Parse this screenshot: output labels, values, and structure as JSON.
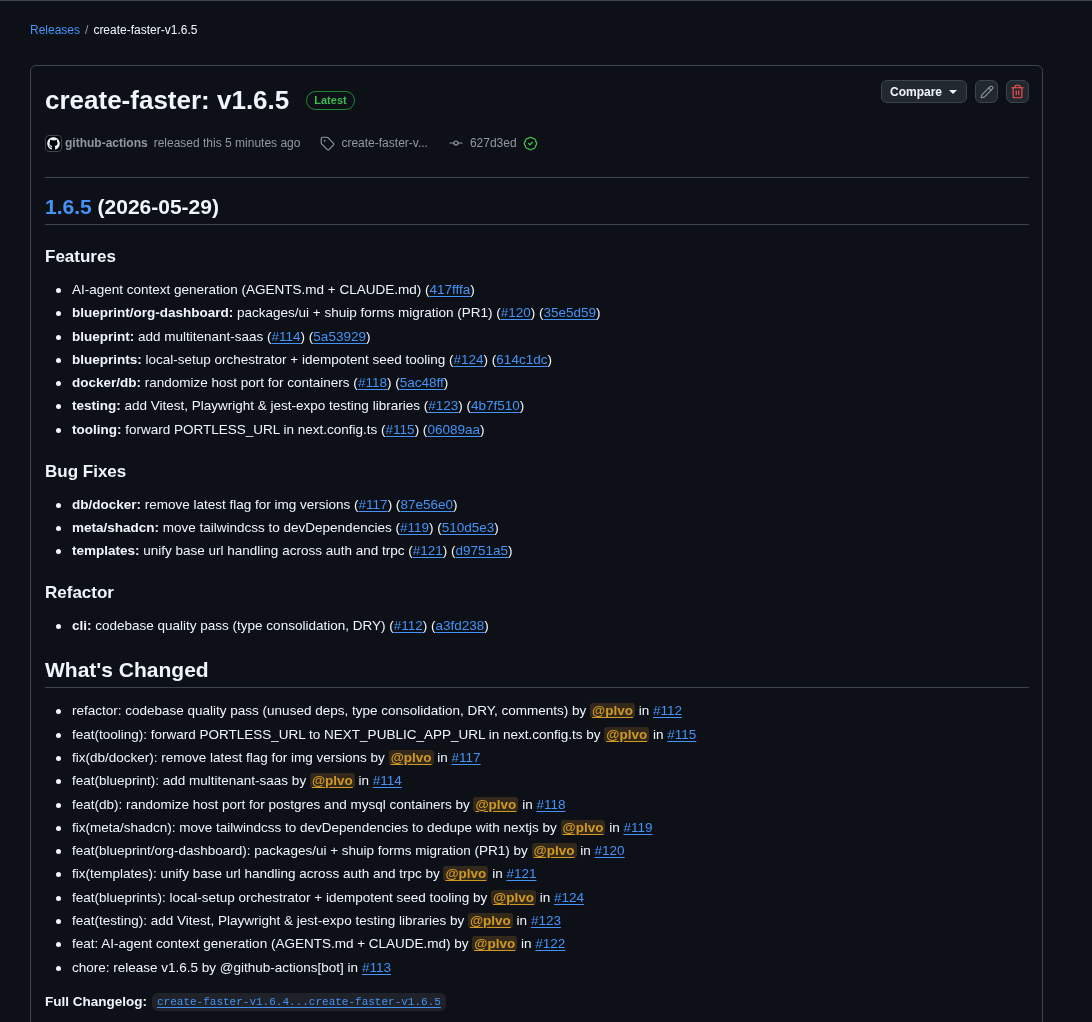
{
  "breadcrumb": {
    "parent": "Releases",
    "separator": "/",
    "current": "create-faster-v1.6.5"
  },
  "release": {
    "title": "create-faster: v1.6.5",
    "badge": "Latest"
  },
  "actions": [
    {
      "kind": "dropdown",
      "label": "Compare"
    },
    {
      "kind": "edit"
    },
    {
      "kind": "delete"
    }
  ],
  "meta": {
    "author": "github-actions",
    "action": "released this 5 minutes ago",
    "tag": "create-faster-v...",
    "commit": "627d3ed",
    "verified": true
  },
  "version": {
    "link": "1.6.5",
    "date": "(2026-05-29)"
  },
  "sections": [
    {
      "heading": "Features",
      "items": [
        {
          "parts": [
            {
              "kind": "text",
              "text": "AI-agent context generation (AGENTS.md + CLAUDE.md) ("
            },
            {
              "kind": "commit",
              "text": "417fffa"
            },
            {
              "kind": "text",
              "text": ")"
            }
          ]
        },
        {
          "parts": [
            {
              "kind": "text",
              "text": "**blueprint/org-dashboard:** packages/ui + shuip forms migration (PR1) ("
            },
            {
              "kind": "pr",
              "text": "#120"
            },
            {
              "kind": "text",
              "text": ") ("
            },
            {
              "kind": "commit",
              "text": "35e5d59"
            },
            {
              "kind": "text",
              "text": ")"
            }
          ]
        },
        {
          "parts": [
            {
              "kind": "text",
              "text": "**blueprint:** add multitenant-saas ("
            },
            {
              "kind": "pr",
              "text": "#114"
            },
            {
              "kind": "text",
              "text": ") ("
            },
            {
              "kind": "commit",
              "text": "5a53929"
            },
            {
              "kind": "text",
              "text": ")"
            }
          ]
        },
        {
          "parts": [
            {
              "kind": "text",
              "text": "**blueprints:** local-setup orchestrator + idempotent seed tooling ("
            },
            {
              "kind": "pr",
              "text": "#124"
            },
            {
              "kind": "text",
              "text": ") ("
            },
            {
              "kind": "commit",
              "text": "614c1dc"
            },
            {
              "kind": "text",
              "text": ")"
            }
          ]
        },
        {
          "parts": [
            {
              "kind": "text",
              "text": "**docker/db:** randomize host port for containers ("
            },
            {
              "kind": "pr",
              "text": "#118"
            },
            {
              "kind": "text",
              "text": ") ("
            },
            {
              "kind": "commit",
              "text": "5ac48ff"
            },
            {
              "kind": "text",
              "text": ")"
            }
          ]
        },
        {
          "parts": [
            {
              "kind": "text",
              "text": "**testing:** add Vitest, Playwright & jest-expo testing libraries ("
            },
            {
              "kind": "pr",
              "text": "#123"
            },
            {
              "kind": "text",
              "text": ") ("
            },
            {
              "kind": "commit",
              "text": "4b7f510"
            },
            {
              "kind": "text",
              "text": ")"
            }
          ]
        },
        {
          "parts": [
            {
              "kind": "text",
              "text": "**tooling:** forward PORTLESS_URL in next.config.ts ("
            },
            {
              "kind": "pr",
              "text": "#115"
            },
            {
              "kind": "text",
              "text": ") ("
            },
            {
              "kind": "commit",
              "text": "06089aa"
            },
            {
              "kind": "text",
              "text": ")"
            }
          ]
        }
      ]
    },
    {
      "heading": "Bug Fixes",
      "items": [
        {
          "parts": [
            {
              "kind": "text",
              "text": "**db/docker:** remove latest flag for img versions ("
            },
            {
              "kind": "pr",
              "text": "#117"
            },
            {
              "kind": "text",
              "text": ") ("
            },
            {
              "kind": "commit",
              "text": "87e56e0"
            },
            {
              "kind": "text",
              "text": ")"
            }
          ]
        },
        {
          "parts": [
            {
              "kind": "text",
              "text": "**meta/shadcn:** move tailwindcss to devDependencies ("
            },
            {
              "kind": "pr",
              "text": "#119"
            },
            {
              "kind": "text",
              "text": ") ("
            },
            {
              "kind": "commit",
              "text": "510d5e3"
            },
            {
              "kind": "text",
              "text": ")"
            }
          ]
        },
        {
          "parts": [
            {
              "kind": "text",
              "text": "**templates:** unify base url handling across auth and trpc ("
            },
            {
              "kind": "pr",
              "text": "#121"
            },
            {
              "kind": "text",
              "text": ") ("
            },
            {
              "kind": "commit",
              "text": "d9751a5"
            },
            {
              "kind": "text",
              "text": ")"
            }
          ]
        }
      ]
    },
    {
      "heading": "Refactor",
      "items": [
        {
          "parts": [
            {
              "kind": "text",
              "text": "**cli:** codebase quality pass (type consolidation, DRY) ("
            },
            {
              "kind": "pr",
              "text": "#112"
            },
            {
              "kind": "text",
              "text": ") ("
            },
            {
              "kind": "commit",
              "text": "a3fd238"
            },
            {
              "kind": "text",
              "text": ")"
            }
          ]
        }
      ]
    }
  ],
  "whats_changed": {
    "heading": "What's Changed",
    "items": [
      {
        "parts": [
          {
            "kind": "text",
            "text": "refactor: codebase quality pass (unused deps, type consolidation, DRY, comments) by "
          },
          {
            "kind": "mention",
            "text": "@plvo"
          },
          {
            "kind": "text",
            "text": " in "
          },
          {
            "kind": "pr",
            "text": "#112"
          }
        ]
      },
      {
        "parts": [
          {
            "kind": "text",
            "text": "feat(tooling): forward PORTLESS_URL to NEXT_PUBLIC_APP_URL in next.config.ts by "
          },
          {
            "kind": "mention",
            "text": "@plvo"
          },
          {
            "kind": "text",
            "text": " in "
          },
          {
            "kind": "pr",
            "text": "#115"
          }
        ]
      },
      {
        "parts": [
          {
            "kind": "text",
            "text": "fix(db/docker): remove latest flag for img versions by "
          },
          {
            "kind": "mention",
            "text": "@plvo"
          },
          {
            "kind": "text",
            "text": " in "
          },
          {
            "kind": "pr",
            "text": "#117"
          }
        ]
      },
      {
        "parts": [
          {
            "kind": "text",
            "text": "feat(blueprint): add multitenant-saas by "
          },
          {
            "kind": "mention",
            "text": "@plvo"
          },
          {
            "kind": "text",
            "text": " in "
          },
          {
            "kind": "pr",
            "text": "#114"
          }
        ]
      },
      {
        "parts": [
          {
            "kind": "text",
            "text": "feat(db): randomize host port for postgres and mysql containers by "
          },
          {
            "kind": "mention",
            "text": "@plvo"
          },
          {
            "kind": "text",
            "text": " in "
          },
          {
            "kind": "pr",
            "text": "#118"
          }
        ]
      },
      {
        "parts": [
          {
            "kind": "text",
            "text": "fix(meta/shadcn): move tailwindcss to devDependencies to dedupe with nextjs by "
          },
          {
            "kind": "mention",
            "text": "@plvo"
          },
          {
            "kind": "text",
            "text": " in "
          },
          {
            "kind": "pr",
            "text": "#119"
          }
        ]
      },
      {
        "parts": [
          {
            "kind": "text",
            "text": "feat(blueprint/org-dashboard): packages/ui + shuip forms migration (PR1) by "
          },
          {
            "kind": "mention",
            "text": "@plvo"
          },
          {
            "kind": "text",
            "text": " in "
          },
          {
            "kind": "pr",
            "text": "#120"
          }
        ]
      },
      {
        "parts": [
          {
            "kind": "text",
            "text": "fix(templates): unify base url handling across auth and trpc by "
          },
          {
            "kind": "mention",
            "text": "@plvo"
          },
          {
            "kind": "text",
            "text": " in "
          },
          {
            "kind": "pr",
            "text": "#121"
          }
        ]
      },
      {
        "parts": [
          {
            "kind": "text",
            "text": "feat(blueprints): local-setup orchestrator + idempotent seed tooling by "
          },
          {
            "kind": "mention",
            "text": "@plvo"
          },
          {
            "kind": "text",
            "text": " in "
          },
          {
            "kind": "pr",
            "text": "#124"
          }
        ]
      },
      {
        "parts": [
          {
            "kind": "text",
            "text": "feat(testing): add Vitest, Playwright & jest-expo testing libraries by "
          },
          {
            "kind": "mention",
            "text": "@plvo"
          },
          {
            "kind": "text",
            "text": " in "
          },
          {
            "kind": "pr",
            "text": "#123"
          }
        ]
      },
      {
        "parts": [
          {
            "kind": "text",
            "text": "feat: AI-agent context generation (AGENTS.md + CLAUDE.md) by "
          },
          {
            "kind": "mention",
            "text": "@plvo"
          },
          {
            "kind": "text",
            "text": " in "
          },
          {
            "kind": "pr",
            "text": "#122"
          }
        ]
      },
      {
        "parts": [
          {
            "kind": "text",
            "text": "chore: release v1.6.5 by @github-actions[bot] in "
          },
          {
            "kind": "pr",
            "text": "#113"
          }
        ]
      }
    ]
  },
  "full_changelog": {
    "label": "Full Changelog:",
    "link": "create-faster-v1.6.4...create-faster-v1.6.5"
  }
}
